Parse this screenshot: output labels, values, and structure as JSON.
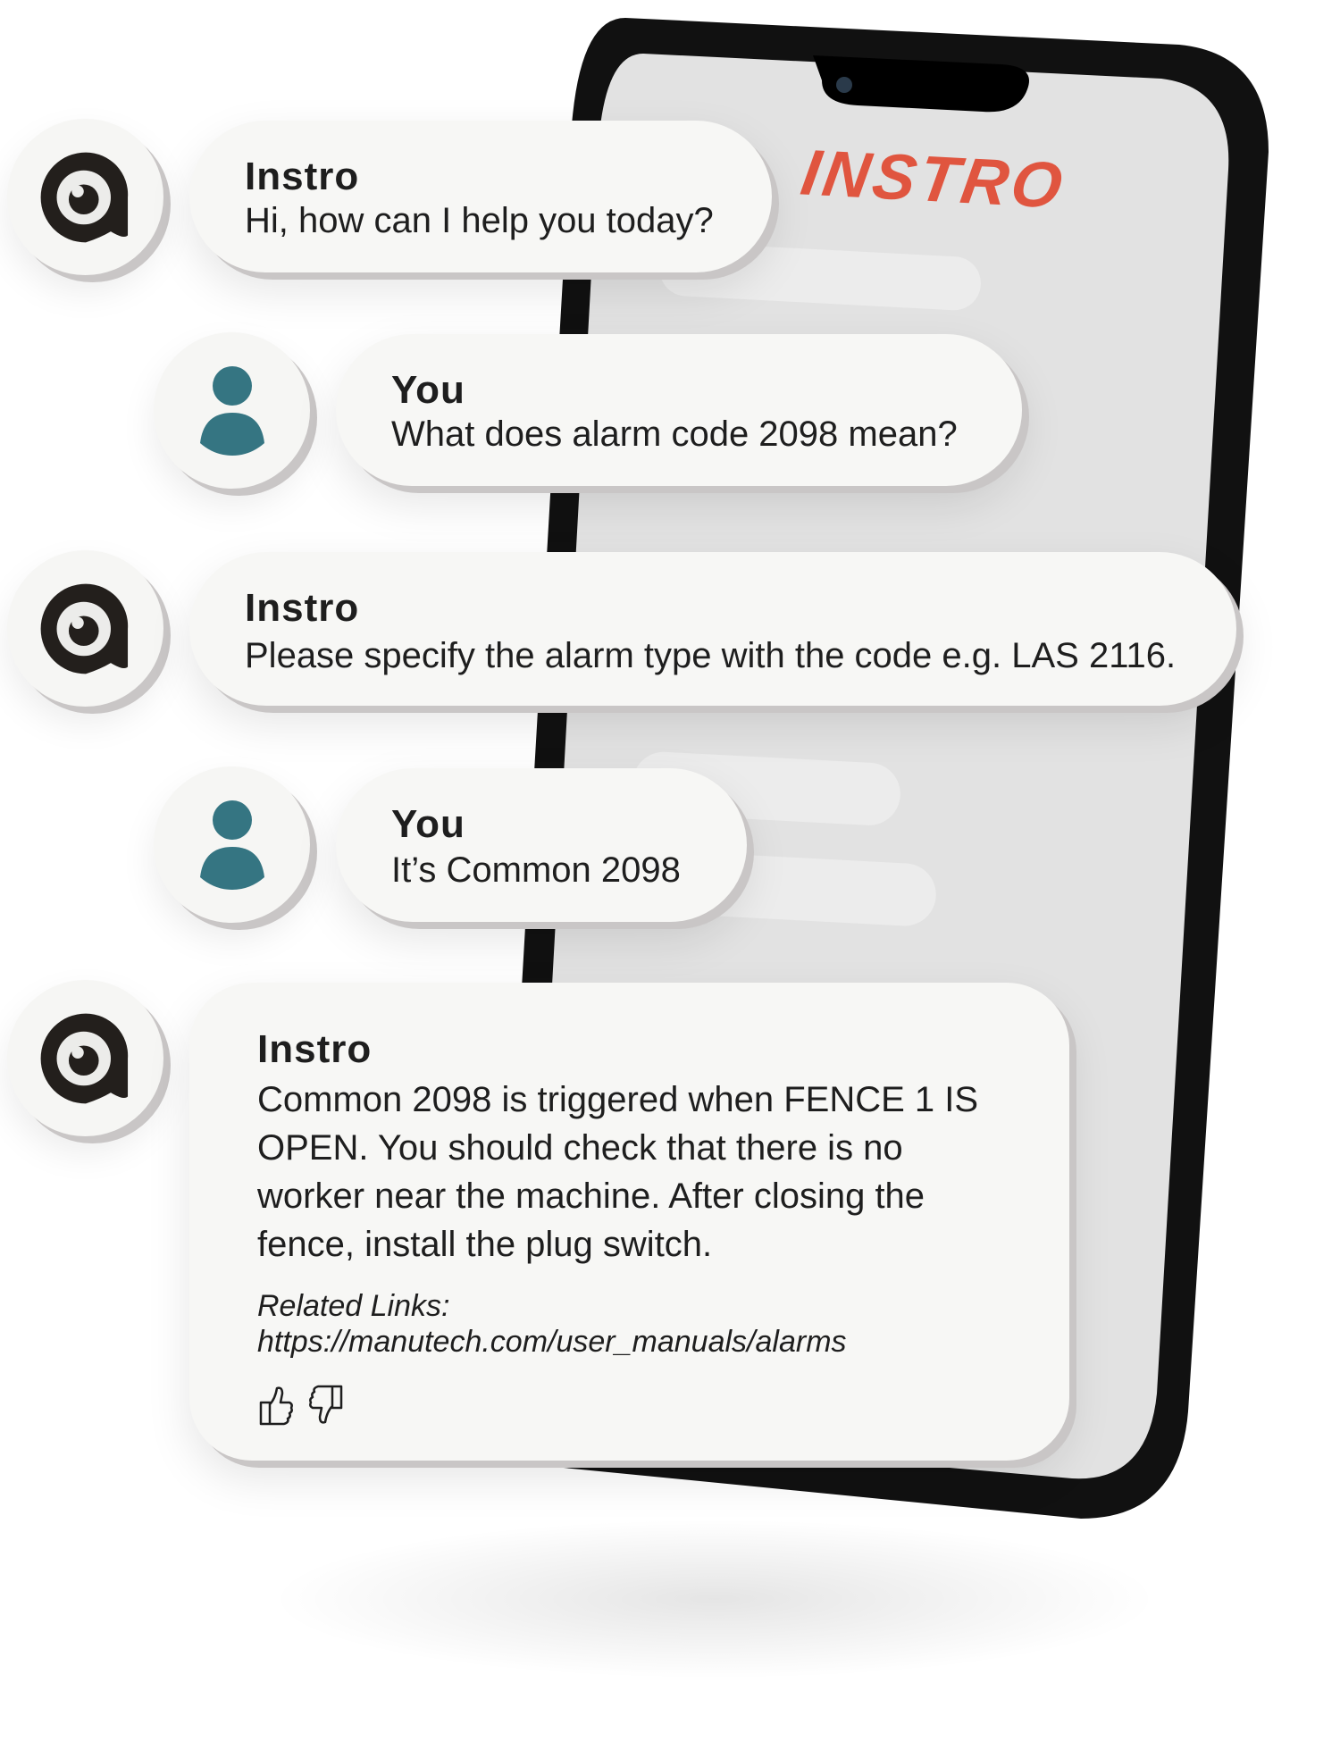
{
  "brand": {
    "logo_text": "INSTRO",
    "accent_color": "#e0553f"
  },
  "colors": {
    "bot_avatar": "#231f1c",
    "user_avatar": "#357582",
    "bubble_bg": "#f7f7f5"
  },
  "messages": [
    {
      "sender": "Instro",
      "role": "bot",
      "text": "Hi, how can I help you today?"
    },
    {
      "sender": "You",
      "role": "user",
      "text": "What does alarm code 2098 mean?"
    },
    {
      "sender": "Instro",
      "role": "bot",
      "text": "Please specify the alarm type with the code e.g. LAS 2116."
    },
    {
      "sender": "You",
      "role": "user",
      "text": "It’s Common 2098"
    },
    {
      "sender": "Instro",
      "role": "bot",
      "lines": [
        "Common 2098 is triggered when FENCE 1 IS",
        "OPEN.  You should check that there is no",
        "worker near the machine.  After closing the",
        "fence, install the plug switch."
      ],
      "related_label": "Related Links:",
      "related_link": "https://manutech.com/user_manuals/alarms",
      "feedback": [
        "thumbs-up-icon",
        "thumbs-down-icon"
      ]
    }
  ]
}
